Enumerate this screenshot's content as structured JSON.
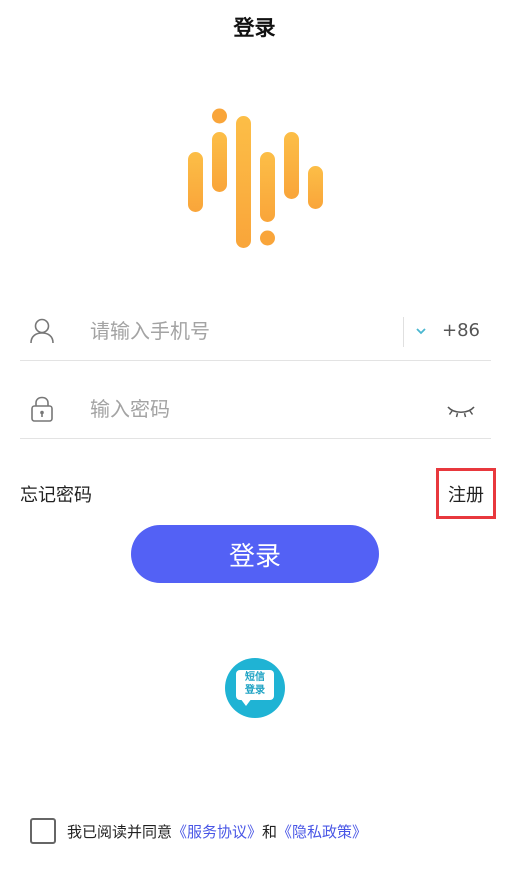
{
  "header": {
    "title": "登录"
  },
  "logo": {
    "name": "audio-wave-logo",
    "colors": [
      "#f9a53a",
      "#fcbe47"
    ]
  },
  "phone_field": {
    "placeholder": "请输入手机号",
    "value": "",
    "country_code": "+86",
    "icon": "user-icon"
  },
  "password_field": {
    "placeholder": "输入密码",
    "value": "",
    "icon": "lock-icon",
    "toggle_icon": "eye-closed-icon"
  },
  "links": {
    "forgot": "忘记密码",
    "register": "注册"
  },
  "login_button": {
    "label": "登录",
    "color": "#5361f5"
  },
  "sms_login": {
    "label": "短信\n登录",
    "color": "#1fb3d4"
  },
  "agreement": {
    "checked": false,
    "prefix": "我已阅读并同意",
    "service": "《服务协议》",
    "and": "和",
    "privacy": "《隐私政策》",
    "link_color": "#4a57e6"
  },
  "highlight": {
    "color": "#e8383d"
  }
}
